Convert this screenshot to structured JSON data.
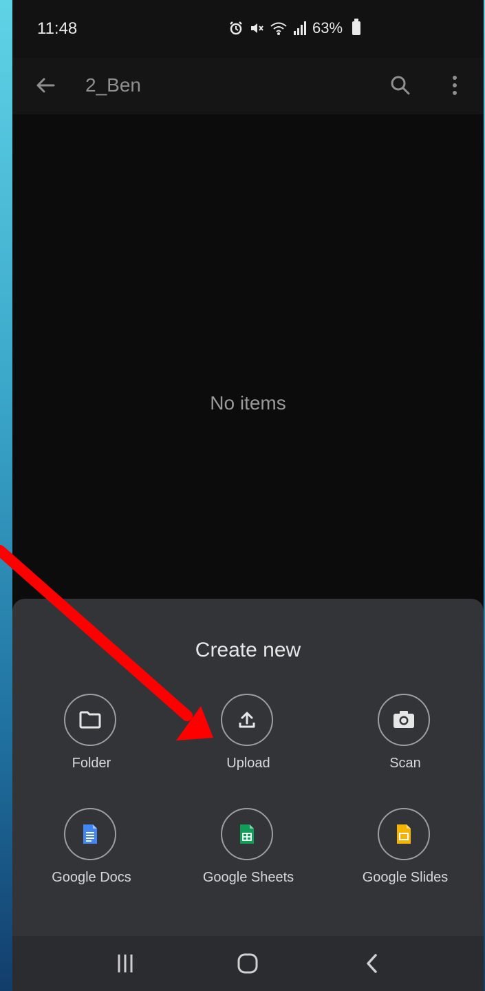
{
  "status": {
    "time": "11:48",
    "battery": "63%"
  },
  "header": {
    "title": "2_Ben"
  },
  "content": {
    "empty_message": "No items"
  },
  "sheet": {
    "title": "Create new",
    "options": [
      {
        "label": "Folder",
        "icon": "folder-icon"
      },
      {
        "label": "Upload",
        "icon": "upload-icon"
      },
      {
        "label": "Scan",
        "icon": "camera-icon"
      },
      {
        "label": "Google Docs",
        "icon": "google-docs-icon",
        "color": "#4285f4"
      },
      {
        "label": "Google Sheets",
        "icon": "google-sheets-icon",
        "color": "#0f9d58"
      },
      {
        "label": "Google Slides",
        "icon": "google-slides-icon",
        "color": "#f4b400"
      }
    ]
  },
  "annotation": {
    "arrow_color": "#ff0000"
  }
}
